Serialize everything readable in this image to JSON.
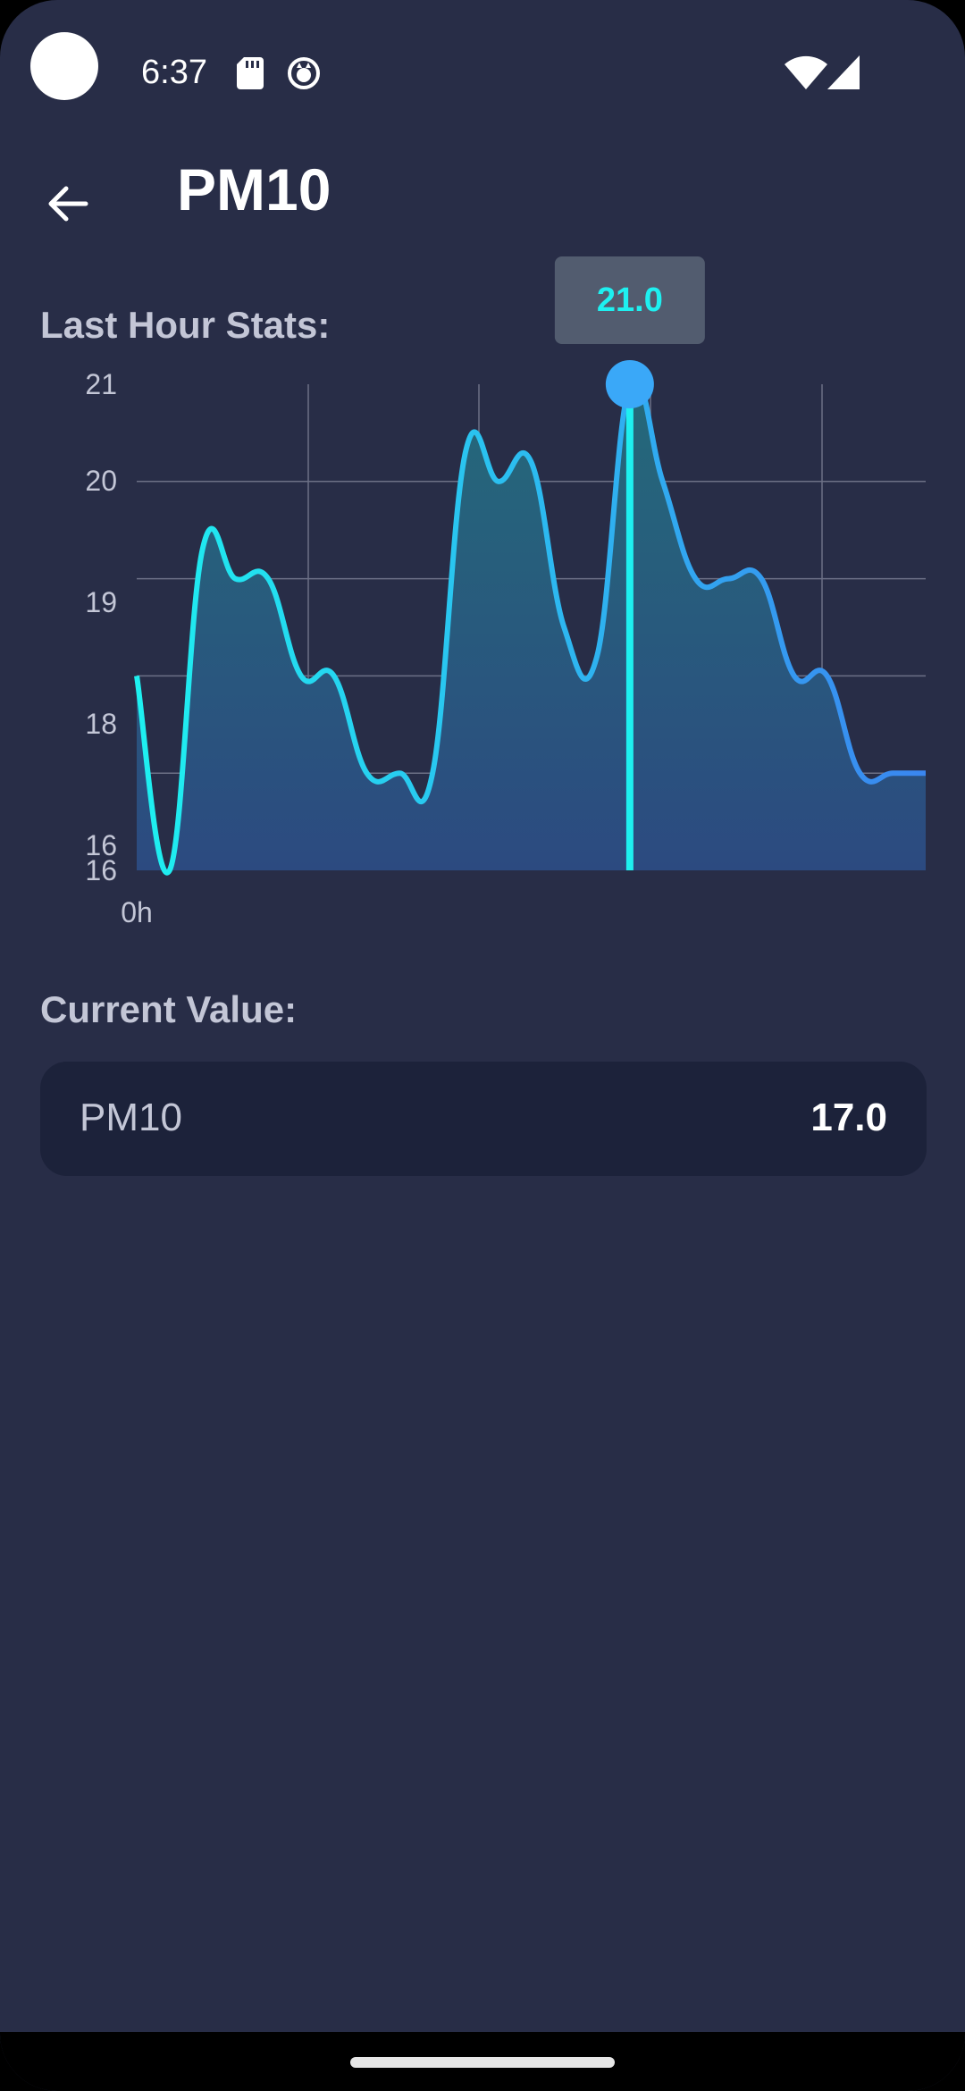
{
  "status_bar": {
    "time": "6:37",
    "icons": [
      "sd-card-icon",
      "cat-icon",
      "wifi-icon",
      "signal-icon"
    ]
  },
  "app_bar": {
    "back_icon": "arrow-left-icon",
    "title": "PM10"
  },
  "stats": {
    "label": "Last Hour Stats:"
  },
  "chart_data": {
    "type": "area",
    "x_tick_labels": [
      "0h"
    ],
    "y_tick_labels": [
      "21",
      "20",
      "19",
      "18",
      "16",
      "16"
    ],
    "ylim": [
      16,
      21
    ],
    "grid": true,
    "x": [
      0,
      1,
      2,
      3,
      4,
      5,
      6,
      7,
      8,
      9,
      10,
      11,
      12,
      13,
      14,
      15,
      16,
      17,
      18,
      19,
      20,
      21,
      22,
      23,
      24
    ],
    "values": [
      18.0,
      16.0,
      19.3,
      19.0,
      19.0,
      18.0,
      18.0,
      17.0,
      17.0,
      17.0,
      20.3,
      20.0,
      20.2,
      18.5,
      18.2,
      21.0,
      20.0,
      19.0,
      19.0,
      19.0,
      18.0,
      18.0,
      17.0,
      17.0,
      17.0
    ],
    "tooltip": {
      "x": 15,
      "value": "21.0"
    },
    "colors": {
      "line_start": "#1ef0f0",
      "line_end": "#3a86f0",
      "fill_top": "#246a7a",
      "fill_bottom": "#2c4a80",
      "grid": "#6c7086",
      "tooltip_bg": "#525c6f",
      "tooltip_text": "#1ef0f0",
      "indicator_line": "#1ef0f0",
      "indicator_dot": "#3aa8f8"
    }
  },
  "current": {
    "label": "Current Value:",
    "card": {
      "name": "PM10",
      "value": "17.0"
    }
  }
}
